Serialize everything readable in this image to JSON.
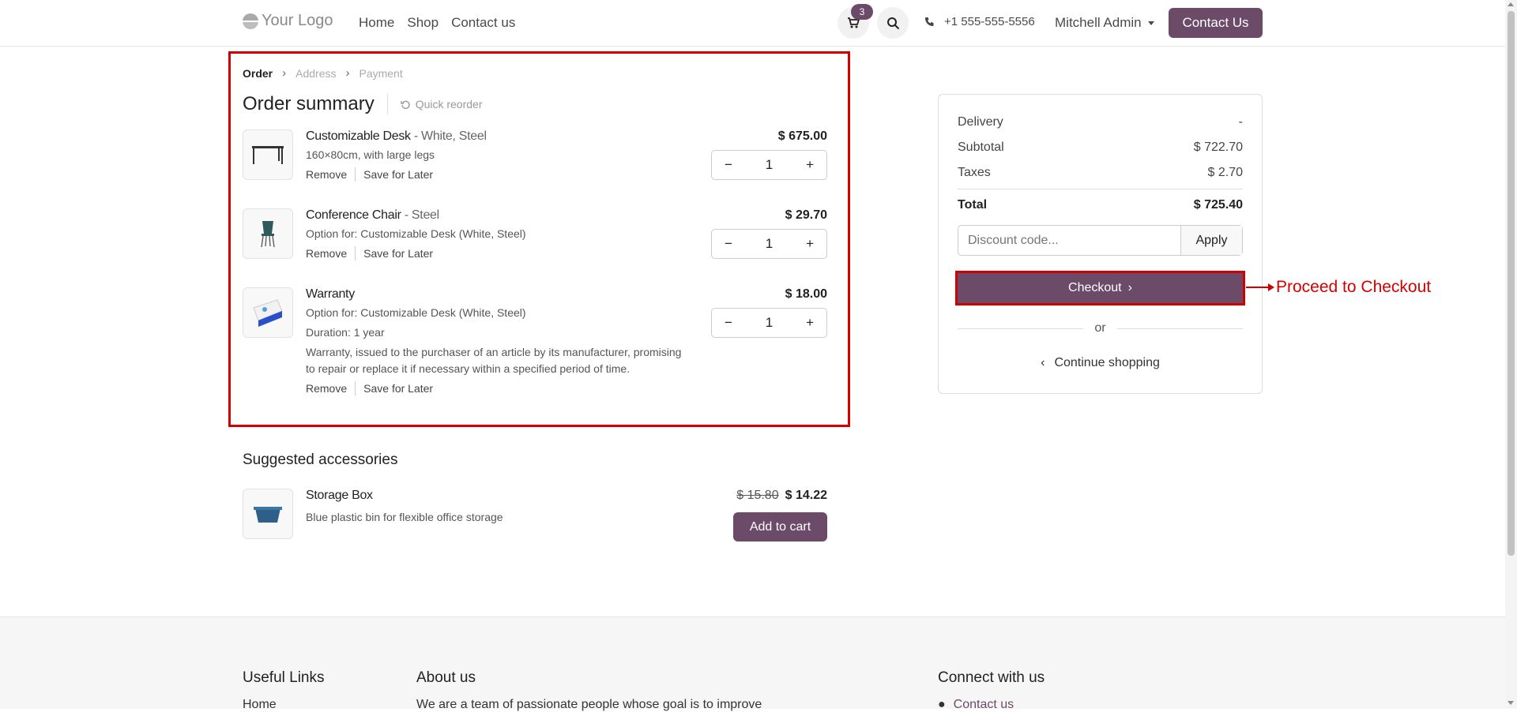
{
  "header": {
    "logo_text": "Your Logo",
    "nav": [
      "Home",
      "Shop",
      "Contact us"
    ],
    "cart_count": "3",
    "phone": "+1 555-555-5556",
    "user": "Mitchell Admin",
    "contact_button": "Contact Us"
  },
  "breadcrumb": {
    "steps": [
      "Order",
      "Address",
      "Payment"
    ],
    "active": "Order"
  },
  "order": {
    "title": "Order summary",
    "quick_reorder": "Quick reorder",
    "items": [
      {
        "name": "Customizable Desk",
        "variant": " - White, Steel",
        "desc": [
          "160×80cm, with large legs"
        ],
        "price": "$ 675.00",
        "qty": "1",
        "remove": "Remove",
        "save": "Save for Later",
        "icon": "desk-image"
      },
      {
        "name": "Conference Chair",
        "variant": " - Steel",
        "desc": [
          "Option for: Customizable Desk (White, Steel)"
        ],
        "price": "$ 29.70",
        "qty": "1",
        "remove": "Remove",
        "save": "Save for Later",
        "icon": "chair-image"
      },
      {
        "name": "Warranty",
        "variant": "",
        "desc": [
          "Option for: Customizable Desk (White, Steel)",
          "Duration: 1 year",
          "Warranty, issued to the purchaser of an article by its manufacturer, promising to repair or replace it if necessary within a specified period of time."
        ],
        "price": "$ 18.00",
        "qty": "1",
        "remove": "Remove",
        "save": "Save for Later",
        "icon": "warranty-image"
      }
    ]
  },
  "suggested": {
    "title": "Suggested accessories",
    "items": [
      {
        "name": "Storage Box",
        "desc": "Blue plastic bin for flexible office storage",
        "old_price": "$ 15.80",
        "price": "$ 14.22",
        "button": "Add to cart"
      }
    ]
  },
  "summary": {
    "delivery_label": "Delivery",
    "delivery_value": "-",
    "subtotal_label": "Subtotal",
    "subtotal_value": "$ 722.70",
    "taxes_label": "Taxes",
    "taxes_value": "$ 2.70",
    "total_label": "Total",
    "total_value": "$ 725.40",
    "discount_placeholder": "Discount code...",
    "apply_label": "Apply",
    "checkout_label": "Checkout",
    "or_label": "or",
    "continue_label": "Continue shopping"
  },
  "annotation": {
    "label": "Proceed to Checkout"
  },
  "footer": {
    "useful_links_title": "Useful Links",
    "useful_links_first": "Home",
    "about_title": "About us",
    "about_text": "We are a team of passionate people whose goal is to improve",
    "connect_title": "Connect with us",
    "connect_first": "Contact us"
  },
  "colors": {
    "brand": "#6b4b68",
    "annotation": "#d40000"
  }
}
